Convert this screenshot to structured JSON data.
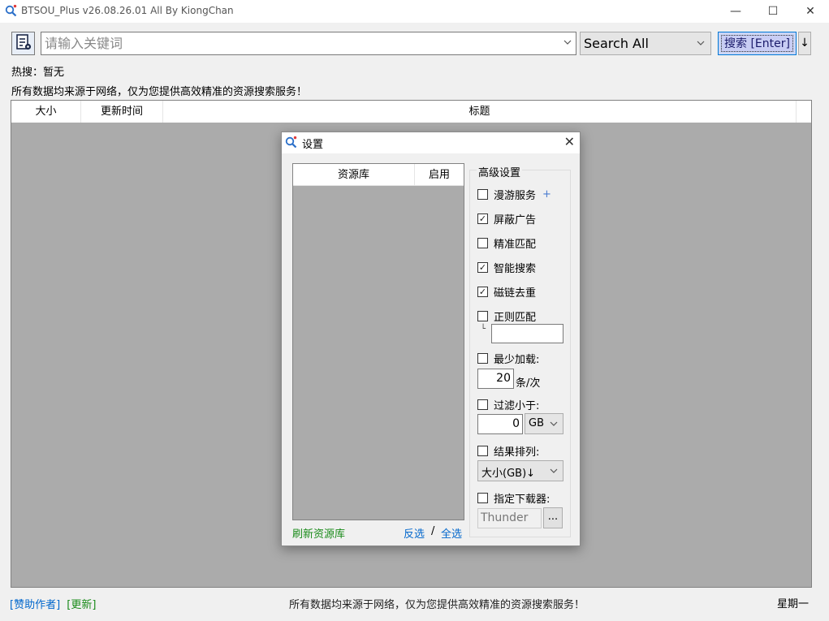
{
  "window": {
    "title": "BTSOU_Plus v26.08.26.01 All By KiongChan",
    "minimize": "—",
    "maximize": "☐",
    "close": "✕"
  },
  "toolbar": {
    "search_placeholder": "请输入关键词",
    "search_value": "",
    "scope_selected": "Search All",
    "search_button": "搜索 [Enter]",
    "sort_button": "↓"
  },
  "hot": "热搜：暂无",
  "notice": "所有数据均来源于网络，仅为您提供高效精准的资源搜索服务！",
  "table": {
    "columns": [
      "大小",
      "更新时间",
      "标题"
    ],
    "rows": []
  },
  "statusbar": {
    "sponsor": "[赞助作者]",
    "update": "[更新]",
    "message": "所有数据均来源于网络，仅为您提供高效精准的资源搜索服务！",
    "weekday": "星期一"
  },
  "dialog": {
    "title": "设置",
    "close": "✕",
    "library": {
      "columns": [
        "资源库",
        "启用"
      ],
      "rows": [],
      "refresh": "刷新资源库",
      "invert": "反选",
      "separator": "/",
      "select_all": "全选"
    },
    "advanced": {
      "legend": "高级设置",
      "roaming": {
        "label": "漫游服务",
        "checked": false,
        "plus": "+"
      },
      "block_ads": {
        "label": "屏蔽广告",
        "checked": true
      },
      "exact_match": {
        "label": "精准匹配",
        "checked": false
      },
      "smart_search": {
        "label": "智能搜索",
        "checked": true
      },
      "magnet_dedup": {
        "label": "磁链去重",
        "checked": true
      },
      "regex_match": {
        "label": "正则匹配",
        "checked": false,
        "corner": "└",
        "value": ""
      },
      "min_load": {
        "label": "最少加载:",
        "checked": false,
        "value": "20",
        "unit": "条/次"
      },
      "filter_smaller": {
        "label": "过滤小于:",
        "checked": false,
        "value": "0",
        "unit_selected": "GB"
      },
      "sort_results": {
        "label": "结果排列:",
        "checked": false,
        "selected": "大小(GB)↓"
      },
      "downloader": {
        "label": "指定下载器:",
        "checked": false,
        "placeholder": "Thunder",
        "browse": "..."
      }
    }
  },
  "icons": {
    "app": "magnifier-icon",
    "settings": "settings-doc-icon",
    "dropdown": "chevron-down-icon",
    "check": "check-icon"
  },
  "colors": {
    "accent": "#0078d7",
    "search_button_bg": "#c8cdf4",
    "link_blue": "#0066cc",
    "link_green": "#188a18",
    "table_empty_bg": "#ababab"
  }
}
